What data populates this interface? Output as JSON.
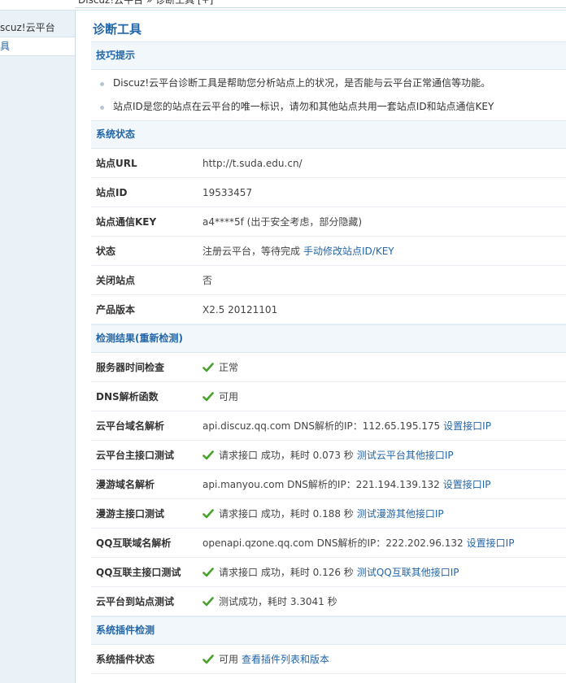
{
  "breadcrumb": "Discuz!云平台 » 诊断工具 [+]",
  "sidebar": {
    "items": [
      {
        "label": "scuz!云平台"
      },
      {
        "label": "具"
      }
    ]
  },
  "page_title": "诊断工具",
  "tips": {
    "heading": "技巧提示",
    "items": [
      "Discuz!云平台诊断工具是帮助您分析站点上的状况，是否能与云平台正常通信等功能。",
      "站点ID是您的站点在云平台的唯一标识，请勿和其他站点共用一套站点ID和站点通信KEY"
    ]
  },
  "system_status": {
    "heading": "系统状态",
    "rows": [
      {
        "label": "站点URL",
        "value": "http://t.suda.edu.cn/"
      },
      {
        "label": "站点ID",
        "value": "19533457"
      },
      {
        "label": "站点通信KEY",
        "value": "a4****5f (出于安全考虑，部分隐藏)"
      },
      {
        "label": "状态",
        "value": "注册云平台，等待完成",
        "link": "手动修改站点ID/KEY"
      },
      {
        "label": "关闭站点",
        "value": "否"
      },
      {
        "label": "产品版本",
        "value": "X2.5 20121101"
      }
    ]
  },
  "check_results": {
    "heading": "检测结果(重新检测)",
    "rows": [
      {
        "label": "服务器时间检查",
        "value": "正常"
      },
      {
        "label": "DNS解析函数",
        "value": "可用"
      },
      {
        "label": "云平台域名解析",
        "value": "api.discuz.qq.com DNS解析的IP：112.65.195.175",
        "link": "设置接口IP"
      },
      {
        "label": "云平台主接口测试",
        "value": "请求接口 成功，耗时 0.073 秒",
        "link": "测试云平台其他接口IP"
      },
      {
        "label": "漫游域名解析",
        "value": "api.manyou.com DNS解析的IP：221.194.139.132",
        "link": "设置接口IP"
      },
      {
        "label": "漫游主接口测试",
        "value": "请求接口 成功，耗时 0.188 秒",
        "link": "测试漫游其他接口IP"
      },
      {
        "label": "QQ互联域名解析",
        "value": "openapi.qzone.qq.com DNS解析的IP：222.202.96.132",
        "link": "设置接口IP"
      },
      {
        "label": "QQ互联主接口测试",
        "value": "请求接口 成功，耗时 0.126 秒",
        "link": "测试QQ互联其他接口IP"
      },
      {
        "label": "云平台到站点测试",
        "value": "测试成功，耗时 3.3041 秒"
      }
    ]
  },
  "plugin_check": {
    "heading": "系统插件检测",
    "rows": [
      {
        "label": "系统插件状态",
        "value": "可用",
        "link": "查看插件列表和版本"
      }
    ]
  },
  "colors": {
    "accent": "#2366a8",
    "check": "#4aa02c",
    "section_bg": "#f2f7fb"
  },
  "icons": {
    "check": "check-icon",
    "bullet": "bullet-icon"
  }
}
